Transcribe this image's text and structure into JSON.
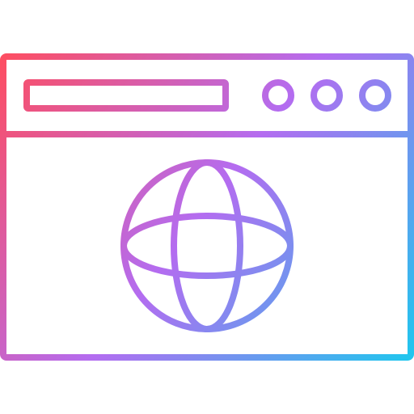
{
  "icon": {
    "name": "browser-globe-icon",
    "style": "outline-gradient",
    "gradient_colors": [
      "#ff4d5e",
      "#b46cf0",
      "#1cc8ee"
    ]
  },
  "window": {
    "controls": [
      "circle",
      "circle",
      "circle"
    ]
  }
}
